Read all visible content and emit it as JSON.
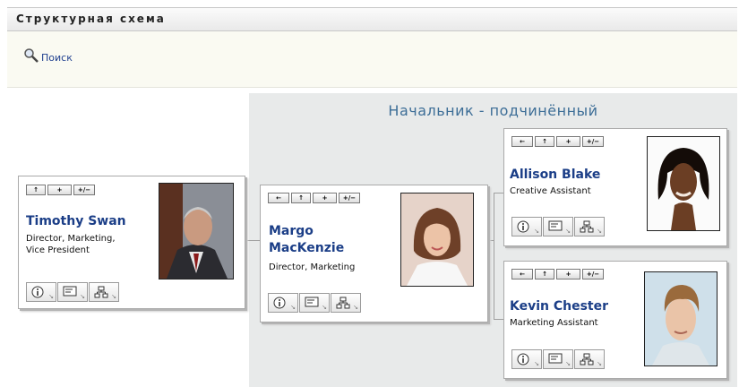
{
  "header": {
    "title": "Структурная схема"
  },
  "toolbar": {
    "search_label": "Поиск",
    "search_icon": "magnifier-icon"
  },
  "chart": {
    "title": "Начальник - подчинённый",
    "card_buttons": {
      "go_to_manager": "←",
      "go_up": "↑",
      "expand": "+",
      "toggle": "+/−"
    },
    "action_icons": [
      "info-icon",
      "email-icon",
      "org-chart-icon"
    ],
    "root": {
      "name": "Timothy Swan",
      "title": "Director, Marketing, Vice President"
    },
    "manager": {
      "name_line1": "Margo",
      "name_line2": "MacKenzie",
      "title": "Director, Marketing"
    },
    "reports": [
      {
        "name": "Allison Blake",
        "title": "Creative Assistant"
      },
      {
        "name": "Kevin Chester",
        "title": "Marketing Assistant"
      }
    ]
  },
  "colors": {
    "link": "#1b3e87",
    "panel_background": "#e8eaea",
    "panel_title": "#3d6e97"
  }
}
